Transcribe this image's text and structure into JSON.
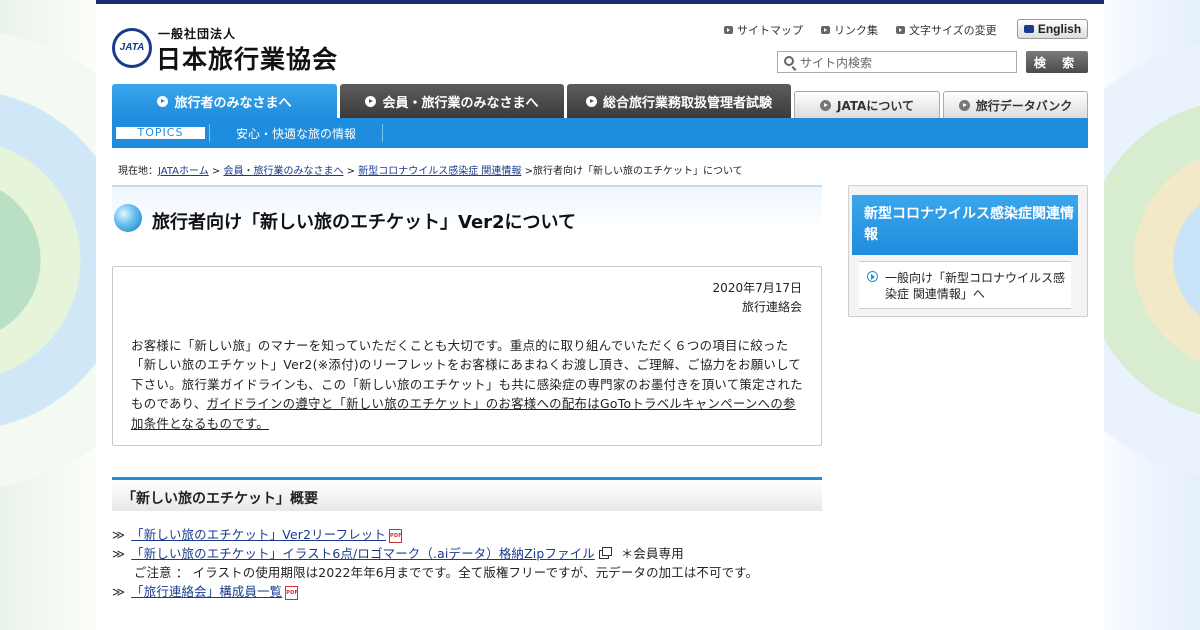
{
  "header": {
    "logo_mark": "JATA",
    "logo_sub": "一般社団法人",
    "logo_name": "日本旅行業協会",
    "util_links": [
      "サイトマップ",
      "リンク集",
      "文字サイズの変更"
    ],
    "english_label": "English",
    "search_placeholder": "サイト内検索",
    "search_button": "検 索"
  },
  "nav": {
    "tabs": [
      "旅行者のみなさまへ",
      "会員・旅行業のみなさまへ",
      "総合旅行業務取扱管理者試験",
      "JATAについて",
      "旅行データバンク"
    ],
    "active_tab": "旅行者のみなさまへ",
    "sub_topics": "TOPICS",
    "sub_link": "安心・快適な旅の情報"
  },
  "breadcrumb": {
    "prefix": "現在地：",
    "items": [
      "JATAホーム",
      "会員・旅行業のみなさまへ",
      "新型コロナウイルス感染症 関連情報"
    ],
    "current": "旅行者向け「新しい旅のエチケット」について"
  },
  "article": {
    "title": "旅行者向け「新しい旅のエチケット」Ver2について",
    "date": "2020年7月17日",
    "author": "旅行連絡会",
    "body_1": "お客様に「新しい旅」のマナーを知っていただくことも大切です。重点的に取り組んでいただく６つの項目に絞った「新しい旅のエチケット」Ver2(※添付)のリーフレットをお客様にあまねくお渡し頂き、ご理解、ご協力をお願いして下さい。旅行業ガイドラインも、この「新しい旅のエチケット」も共に感染症の専門家のお墨付きを頂いて策定されたものであり、",
    "body_underline": "ガイドラインの遵守と「新しい旅のエチケット」のお客様への配布はGoToトラベルキャンペーンへの参加条件となるものです。"
  },
  "section": {
    "heading": "「新しい旅のエチケット」概要",
    "bullet": "≫",
    "downloads": [
      {
        "label": "「新しい旅のエチケット」Ver2リーフレット",
        "icon": "pdf-icon"
      },
      {
        "label": "「新しい旅のエチケット」イラスト6点/ロゴマーク（.aiデータ）格納Zipファイル",
        "icon": "external-window-icon",
        "note": "＊会員専用"
      },
      {
        "label": "「旅行連絡会」構成員一覧",
        "icon": "pdf-icon"
      }
    ],
    "notice": "ご注意 ： イラストの使用期限は2022年年6月までです。全て版権フリーですが、元データの加工は不可です。"
  },
  "sidebar": {
    "heading": "新型コロナウイルス感染症関連情報",
    "item": "一般向け「新型コロナウイルス感染症 関連情報」へ"
  },
  "colors": {
    "brand_blue": "#1f8ddd",
    "navy": "#1a2e6c",
    "dark_tab": "#4a4a4a"
  }
}
